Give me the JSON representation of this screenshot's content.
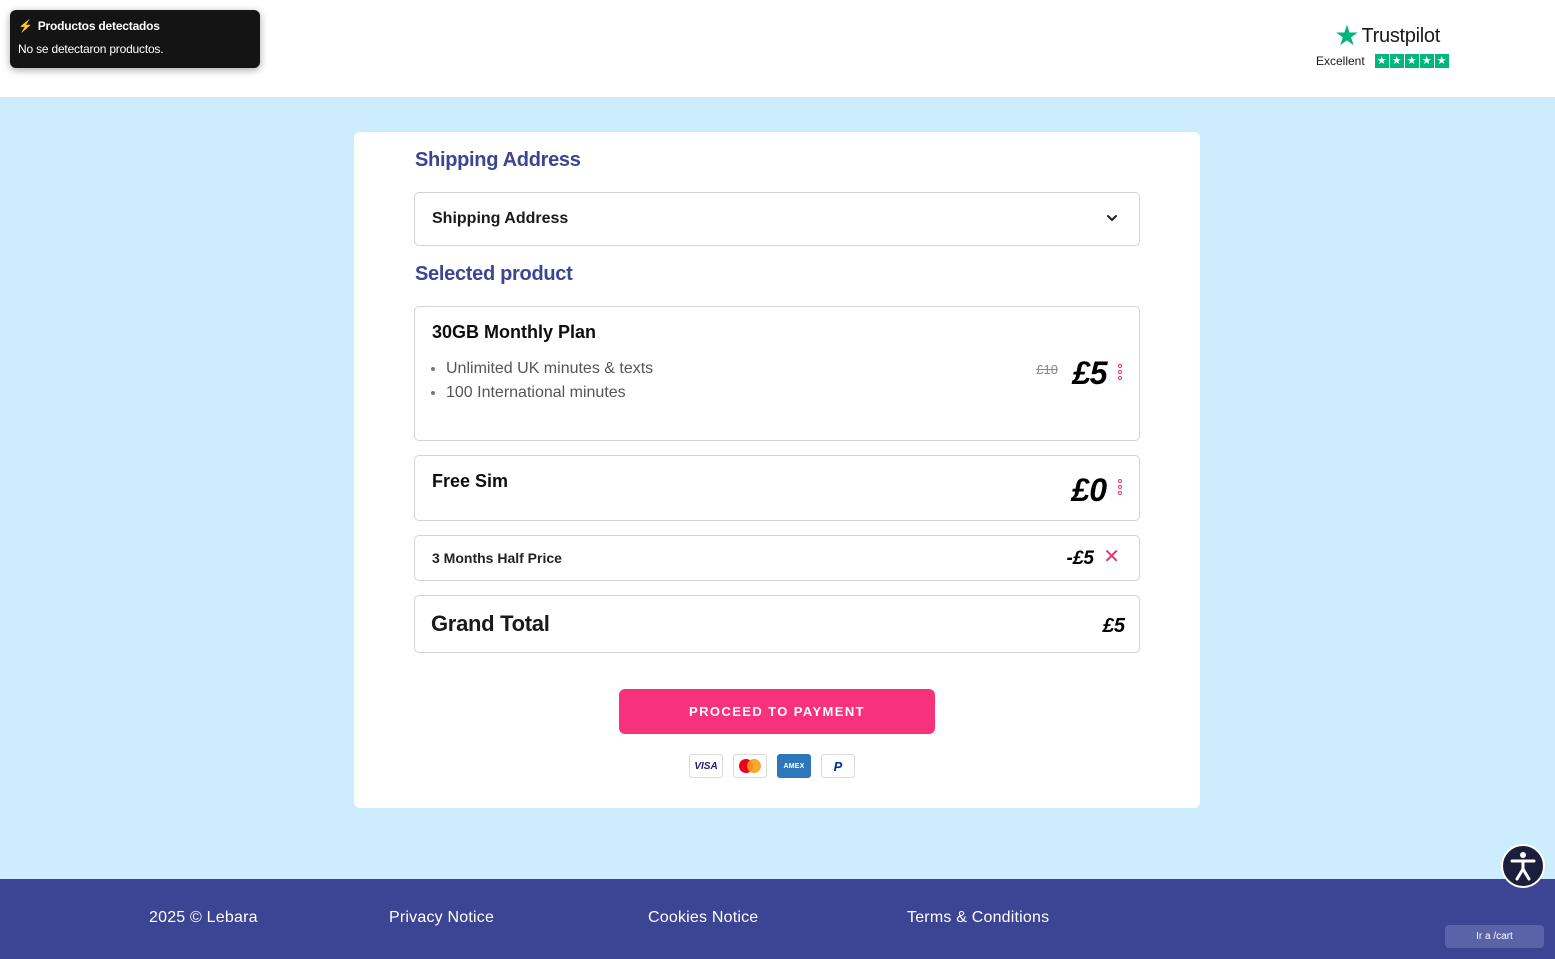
{
  "toast": {
    "title": "Productos detectados",
    "message": "No se detectaron productos."
  },
  "trustpilot": {
    "brand": "Trustpilot",
    "rating_label": "Excellent",
    "stars": 5
  },
  "shipping": {
    "heading": "Shipping Address",
    "select_value": "Shipping Address"
  },
  "selected": {
    "heading": "Selected product",
    "plan": {
      "name": "30GB Monthly Plan",
      "features": [
        "Unlimited UK minutes & texts",
        "100 International minutes"
      ],
      "old_price": "£10",
      "price": "£5"
    },
    "sim": {
      "name": "Free Sim",
      "price": "£0"
    },
    "promo": {
      "name": "3 Months Half Price",
      "discount": "-£5",
      "remove_symbol": "✕"
    },
    "total": {
      "label": "Grand Total",
      "amount": "£5"
    }
  },
  "checkout": {
    "button_label": "PROCEED TO PAYMENT",
    "payment_methods": [
      "VISA",
      "Mastercard",
      "AMEX",
      "PayPal"
    ]
  },
  "footer": {
    "copyright": "2025 © Lebara",
    "links": [
      "Privacy Notice",
      "Cookies Notice",
      "Terms & Conditions"
    ]
  },
  "goto_button": "Ir a /cart",
  "colors": {
    "page_bg": "#cdedfc",
    "heading": "#3b4594",
    "accent": "#f8317d",
    "footer_bg": "#3b4594",
    "trustpilot_green": "#00b67a"
  }
}
